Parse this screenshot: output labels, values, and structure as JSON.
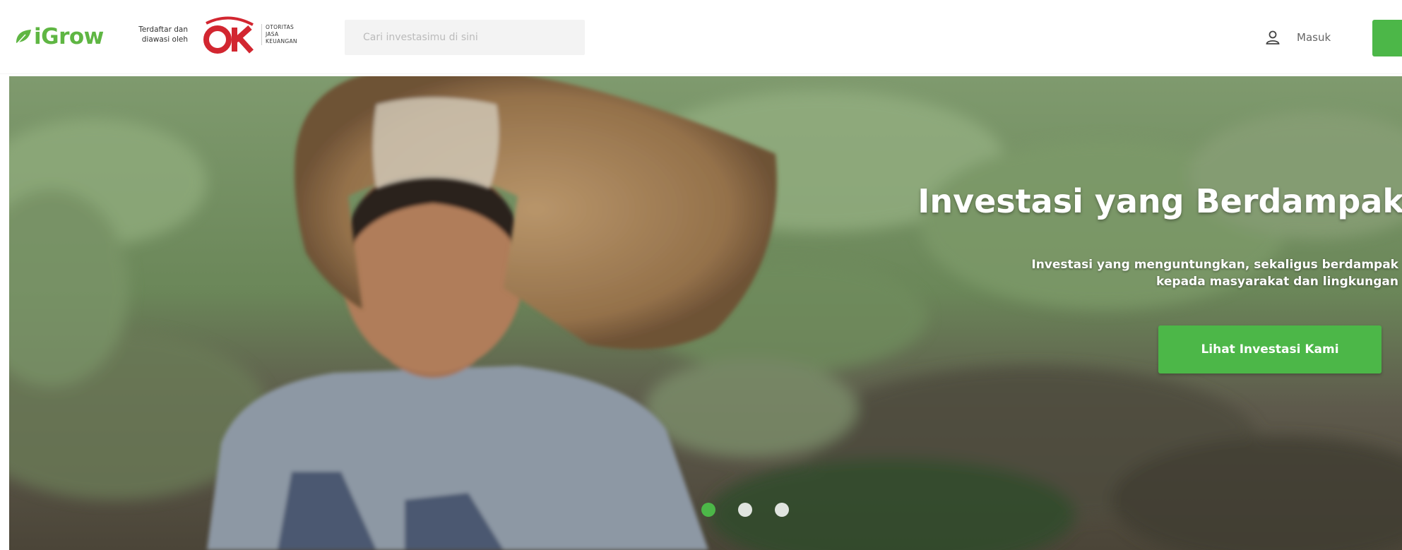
{
  "header": {
    "brand": "iGrow",
    "ojk_caption_line1": "Terdaftar dan",
    "ojk_caption_line2": "diawasi oleh",
    "ojk_logo_text": "OJK",
    "ojk_subtext_line1": "OTORITAS",
    "ojk_subtext_line2": "JASA",
    "ojk_subtext_line3": "KEUANGAN",
    "search_placeholder": "Cari investasimu di sini",
    "login_label": "Masuk"
  },
  "hero": {
    "title": "Investasi yang Berdampak",
    "subtitle_line1": "Investasi yang menguntungkan, sekaligus berdampak",
    "subtitle_line2": "kepada masyarakat dan lingkungan",
    "cta_label": "Lihat Investasi Kami",
    "active_slide": 1
  },
  "colors": {
    "brand_green": "#4cb748",
    "logo_green": "#5fb643",
    "ojk_red": "#d22630"
  },
  "icons": {
    "brand_leaf": "leaf-icon",
    "login": "user-icon"
  }
}
